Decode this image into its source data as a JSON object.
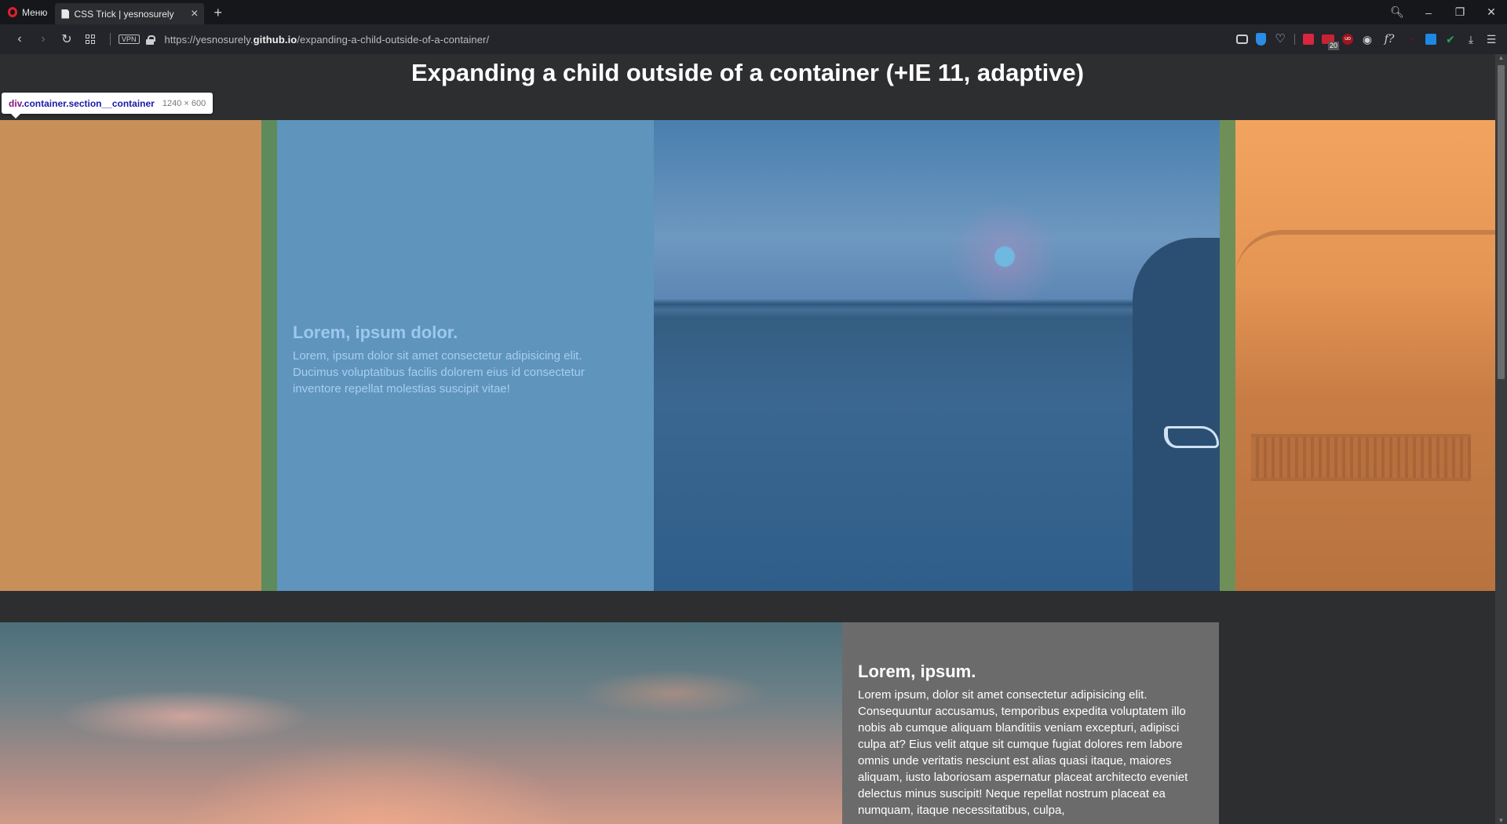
{
  "browser": {
    "menu_label": "Меню",
    "tab_title": "CSS Trick | yesnosurely",
    "tab_close": "×",
    "new_tab": "+",
    "vpn_label": "VPN",
    "url_prefix": "https://",
    "url_host_pre": "yesnosurely.",
    "url_host_bold": "github.io",
    "url_path": "/expanding-a-child-outside-of-a-container/",
    "mail_badge": "20",
    "ublock_label": "uo",
    "fq_label": "f?"
  },
  "page": {
    "title": "Expanding a child outside of a container (+IE 11, adaptive)"
  },
  "inspector_tooltip": {
    "tag": "div",
    "classes": ".container.section__container",
    "dimensions": "1240 × 600"
  },
  "section1": {
    "heading": "Lorem, ipsum dolor.",
    "body": "Lorem, ipsum dolor sit amet consectetur adipisicing elit. Ducimus voluptatibus facilis dolorem eius id consectetur inventore repellat molestias suscipit vitae!"
  },
  "section2": {
    "heading": "Lorem, ipsum.",
    "body": "Lorem ipsum, dolor sit amet consectetur adipisicing elit. Consequuntur accusamus, temporibus expedita voluptatem illo nobis ab cumque aliquam blanditiis veniam excepturi, adipisci culpa at? Eius velit atque sit cumque fugiat dolores rem labore omnis unde veritatis nesciunt est alias quasi itaque, maiores aliquam, iusto laboriosam aspernatur placeat architecto eveniet delectus minus suscipit! Neque repellat nostrum placeat ea numquam, itaque necessitatibus, culpa,"
  },
  "colors": {
    "overlay_margin": "#c88f59",
    "overlay_padding": "#5e8b5c",
    "overlay_content": "#5f94bd",
    "page_bg": "#2d2e30",
    "panel_bg": "#6b6b6b"
  }
}
